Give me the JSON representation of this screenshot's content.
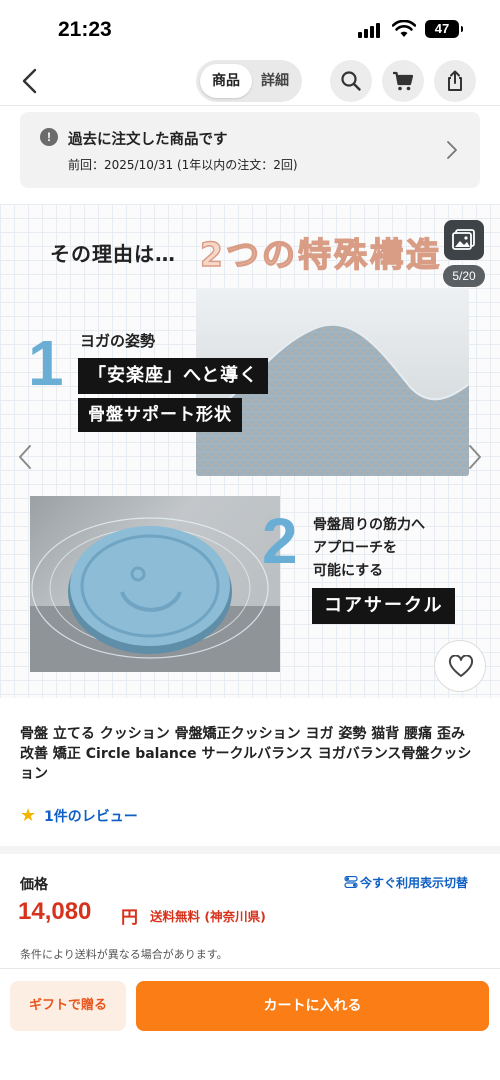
{
  "status_bar": {
    "time": "21:23",
    "battery": "47"
  },
  "nav": {
    "tabs": [
      "商品",
      "詳細"
    ],
    "active_tab": "商品"
  },
  "order_notice": {
    "title": "過去に注文した商品です",
    "detail": "前回：2025/10/31 (1年以内の注文：2回)"
  },
  "carousel": {
    "page_counter": "5/20",
    "headline_lead": "その理由は…",
    "headline_main": "2つの特殊構造",
    "feature1": {
      "number": "1",
      "caption": "ヨガの姿勢",
      "label_a": "「安楽座」へと導く",
      "label_b": "骨盤サポート形状"
    },
    "feature2": {
      "number": "2",
      "lines": [
        "骨盤周りの筋力へ",
        "アプローチを",
        "可能にする"
      ],
      "label": "コアサークル"
    }
  },
  "product": {
    "title": "骨盤 立てる クッション 骨盤矯正クッション ヨガ 姿勢 猫背 腰痛 歪み 改善 矯正 Circle balance サークルバランス ヨガバランス骨盤クッション",
    "review_link": "1件のレビュー",
    "price_label": "価格",
    "display_toggle": "今すぐ利用表示切替",
    "price": "14,080",
    "price_unit": "円",
    "shipping": "送料無料 (神奈川県)",
    "shipping_note": "条件により送料が異なる場合があります。"
  },
  "actions": {
    "gift": "ギフトで贈る",
    "cart": "カートに入れる"
  },
  "colors": {
    "accent": "#fa7d16",
    "price": "#d6331d",
    "link": "#0f5fc4",
    "feature_number": "#6aaed6"
  },
  "icons": [
    "back-icon",
    "search-icon",
    "cart-icon",
    "share-icon",
    "info-icon",
    "chevron-right-icon",
    "gallery-icon",
    "heart-icon",
    "star-icon",
    "toggle-icon"
  ]
}
